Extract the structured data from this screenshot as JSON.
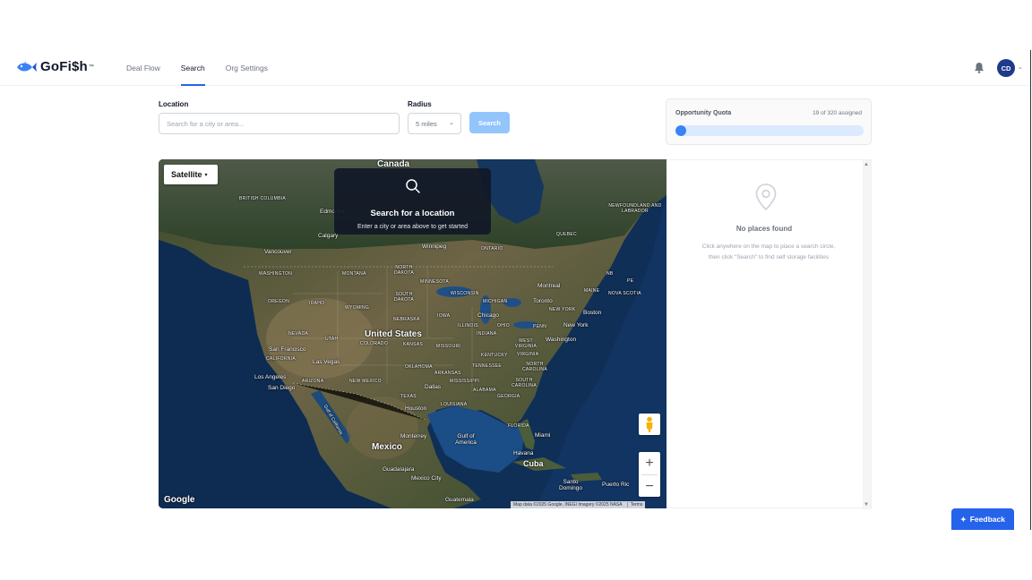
{
  "app": {
    "name": "GoFi$h",
    "trademark": "™"
  },
  "nav": {
    "items": [
      {
        "label": "Deal Flow",
        "active": false
      },
      {
        "label": "Search",
        "active": true
      },
      {
        "label": "Org Settings",
        "active": false
      }
    ]
  },
  "user": {
    "initials": "CD"
  },
  "search": {
    "location_label": "Location",
    "location_placeholder": "Search for a city or area...",
    "location_value": "",
    "radius_label": "Radius",
    "radius_value": "5 miles",
    "button_label": "Search"
  },
  "quota": {
    "title": "Opportunity Quota",
    "count_text": "19 of 320 assigned",
    "fraction": 0.059
  },
  "map": {
    "type_label": "Satellite",
    "overlay_title": "Search for a location",
    "overlay_subtitle": "Enter a city or area above to get started",
    "provider": "Google",
    "attribution": "Map data ©2025 Google, INEGI Imagery ©2025 NASA",
    "terms": "Terms",
    "zoom_in": "+",
    "zoom_out": "−",
    "labels": {
      "canada": "Canada",
      "united_states": "United States",
      "mexico": "Mexico",
      "cuba": "Cuba",
      "british_columbia": "BRITISH COLUMBIA",
      "edmonton": "Edmonton",
      "calgary": "Calgary",
      "vancouver": "Vancouver",
      "washington": "WASHINGTON",
      "oregon": "OREGON",
      "idaho": "IDAHO",
      "montana": "MONTANA",
      "wyoming": "WYOMING",
      "nevada": "NEVADA",
      "utah": "UTAH",
      "california": "CALIFORNIA",
      "arizona": "ARIZONA",
      "new_mexico": "NEW MEXICO",
      "colorado": "COLORADO",
      "north_dakota": "NORTH DAKOTA",
      "south_dakota": "SOUTH DAKOTA",
      "nebraska": "NEBRASKA",
      "kansas": "KANSAS",
      "oklahoma": "OKLAHOMA",
      "texas": "TEXAS",
      "minnesota": "MINNESOTA",
      "iowa": "IOWA",
      "missouri": "MISSOURI",
      "arkansas": "ARKANSAS",
      "louisiana": "LOUISIANA",
      "wisconsin": "WISCONSIN",
      "michigan": "MICHIGAN",
      "illinois": "ILLINOIS",
      "indiana": "INDIANA",
      "ohio": "OHIO",
      "kentucky": "KENTUCKY",
      "tennessee": "TENNESSEE",
      "mississippi": "MISSISSIPPI",
      "alabama": "ALABAMA",
      "georgia": "GEORGIA",
      "florida": "FLORIDA",
      "north_carolina": "NORTH CAROLINA",
      "south_carolina": "SOUTH CAROLINA",
      "virginia": "VIRGINIA",
      "west_virginia": "WEST VIRGINIA",
      "pennsylvania": "PENN",
      "new_york": "NEW YORK",
      "maine": "MAINE",
      "quebec": "QUEBEC",
      "ontario": "ONTARIO",
      "newfoundland": "NEWFOUNDLAND AND LABRADOR",
      "nova_scotia": "NOVA SCOTIA",
      "nb": "NB",
      "pe": "PE",
      "winnipeg": "Winnipeg",
      "chicago": "Chicago",
      "toronto": "Toronto",
      "montreal": "Montreal",
      "boston": "Boston",
      "new_york_city": "New York",
      "washington_dc": "Washington",
      "san_francisco": "San Francisco",
      "las_vegas": "Las Vegas",
      "los_angeles": "Los Angeles",
      "san_diego": "San Diego",
      "dallas": "Dallas",
      "houston": "Houston",
      "miami": "Miami",
      "monterrey": "Monterrey",
      "guadalajara": "Guadalajara",
      "mexico_city": "Mexico City",
      "havana": "Havana",
      "guatemala": "Guatemala",
      "santo_domingo": "Santo Domingo",
      "puerto_rico": "Puerto Ric",
      "gulf_of_america": "Gulf of America",
      "gulf_of_california": "Gulf of California"
    }
  },
  "places": {
    "empty_title": "No places found",
    "hint_line1": "Click anywhere on the map to place a search circle,",
    "hint_line2": "then click \"Search\" to find self storage facilities"
  },
  "feedback": {
    "label": "Feedback"
  },
  "colors": {
    "brand": "#2563eb",
    "search_button_disabled": "#93c5fd",
    "quota_fill": "#3b82f6",
    "quota_track": "#dbeafe",
    "avatar": "#1e3a8a"
  }
}
